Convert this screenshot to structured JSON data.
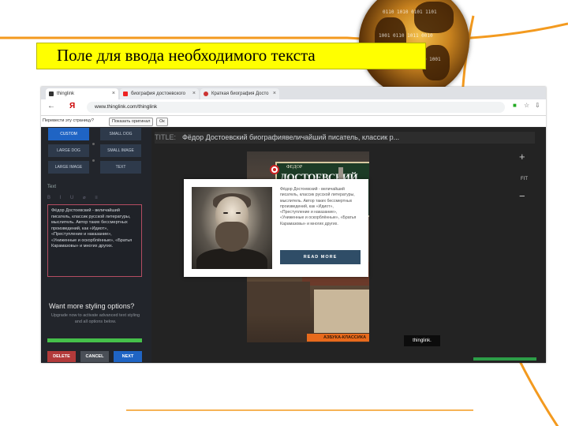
{
  "slide": {
    "title": "Поле для ввода необходимого текста",
    "colors": {
      "title_bar": "#ffff00",
      "curve": "#f39a1f"
    }
  },
  "browser": {
    "tabs": [
      {
        "label": "thinglink",
        "active": true
      },
      {
        "label": "биография достоевского",
        "active": false
      },
      {
        "label": "Краткая биография Досто",
        "active": false
      }
    ],
    "address": "www.thinglink.com/thinglink",
    "bookmarks": {
      "label": "Перевести эту страницу?",
      "select_value": "Показать оригинал",
      "button": "Ок"
    }
  },
  "sidebar": {
    "chips": [
      {
        "label": "CUSTOM",
        "selected": true
      },
      {
        "label": "SMALL DOG",
        "selected": false
      },
      {
        "label": "LARGE DOG",
        "selected": false
      },
      {
        "label": "SMALL IMAGE",
        "selected": false
      },
      {
        "label": "LARGE IMAGE",
        "selected": false
      },
      {
        "label": "TEXT",
        "selected": false
      }
    ],
    "text_label": "Text",
    "format_icons": "B I U ⌀ ≡",
    "description": "Фёдор Достоевский - величайший писатель, классик русской литературы, мыслитель. Автор таких бессмертных произведений, как «Идиот», «Преступление и наказание», «Униженные и оскорблённые», «Братья Карамазовы» и многих других.",
    "more_heading": "Want more styling options?",
    "more_text": "Upgrade now to activate advanced text styling and all options below.",
    "buttons": {
      "delete": "DELETE",
      "cancel": "CANCEL",
      "next": "NEXT"
    }
  },
  "canvas": {
    "title_label": "TITLE:",
    "title_value": "Фёдор Достоевский биографиявеличайший писатель, классик р...",
    "zoom_in": "+",
    "fit": "FIT",
    "zoom_out": "−",
    "book_plate_small": "ФЕДОР",
    "book_plate_big": "ДОСТОЕВСКИЙ",
    "book_ribbon": "АЗБУКА-КЛАССИКА",
    "badge": "thinglink."
  },
  "popup": {
    "text": "Фёдор Достоевский - величайший писатель, классик русской литературы, мыслитель. Автор таких бессмертных произведений, как «Идиот», «Преступление и наказание», «Униженные и оскорблённые», «Братья Карамазовы» и многих других.",
    "read_more": "READ MORE"
  }
}
